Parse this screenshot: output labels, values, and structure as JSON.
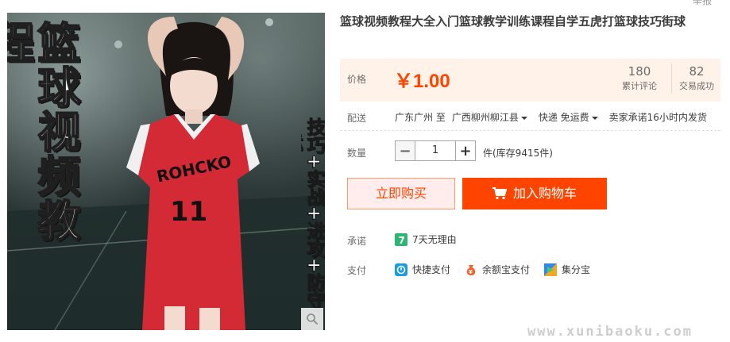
{
  "image": {
    "title_text": "篮球视频教程",
    "subtitle_text": "技巧+实战+进攻+防守+运",
    "jersey_text": "ROHCKO",
    "jersey_number": "11"
  },
  "top_sliver": "举报",
  "product": {
    "title": "篮球视频教程大全入门篮球教学训练课程自学五虎打篮球技巧街球"
  },
  "price": {
    "label": "价格",
    "value": "￥1.00",
    "reviews_count": "180",
    "reviews_label": "累计评论",
    "trades_count": "82",
    "trades_label": "交易成功"
  },
  "shipping": {
    "label": "配送",
    "from": "广东广州 至",
    "to": "广西柳州柳江县",
    "method": "快递 免运费",
    "promise": "卖家承诺16小时内发货"
  },
  "quantity": {
    "label": "数量",
    "minus": "−",
    "value": "1",
    "plus": "+",
    "stock": "件(库存9415件)"
  },
  "buttons": {
    "buy_now": "立即购买",
    "add_to_cart": "加入购物车"
  },
  "promise": {
    "label": "承诺",
    "badge": "7",
    "text": "7天无理由"
  },
  "payment": {
    "label": "支付",
    "methods": [
      "快捷支付",
      "余额宝支付",
      "集分宝"
    ]
  },
  "watermark": "www.xunibaoku.com",
  "colors": {
    "accent": "#ff4400",
    "price_bg": "#fff2e8",
    "buy_now_bg": "#ffeded"
  }
}
